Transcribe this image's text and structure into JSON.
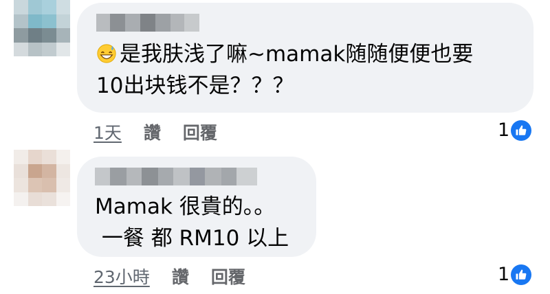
{
  "comments": [
    {
      "text_lines": [
        "是我肤浅了嘛~mamak随随便便也要",
        "10出块钱不是？？？"
      ],
      "time": "1天",
      "like_label": "讚",
      "reply_label": "回覆",
      "reaction_count": "1",
      "emoji": "grinning-sweat-emoji"
    },
    {
      "text_lines": [
        "Mamak 很貴的。。",
        " 一餐 都 RM10 以上"
      ],
      "time": "23小時",
      "like_label": "讚",
      "reply_label": "回覆",
      "reaction_count": "1"
    }
  ],
  "colors": {
    "bubble": "#f0f2f5",
    "meta_text": "#65676b",
    "like_blue": "#1877f2"
  }
}
